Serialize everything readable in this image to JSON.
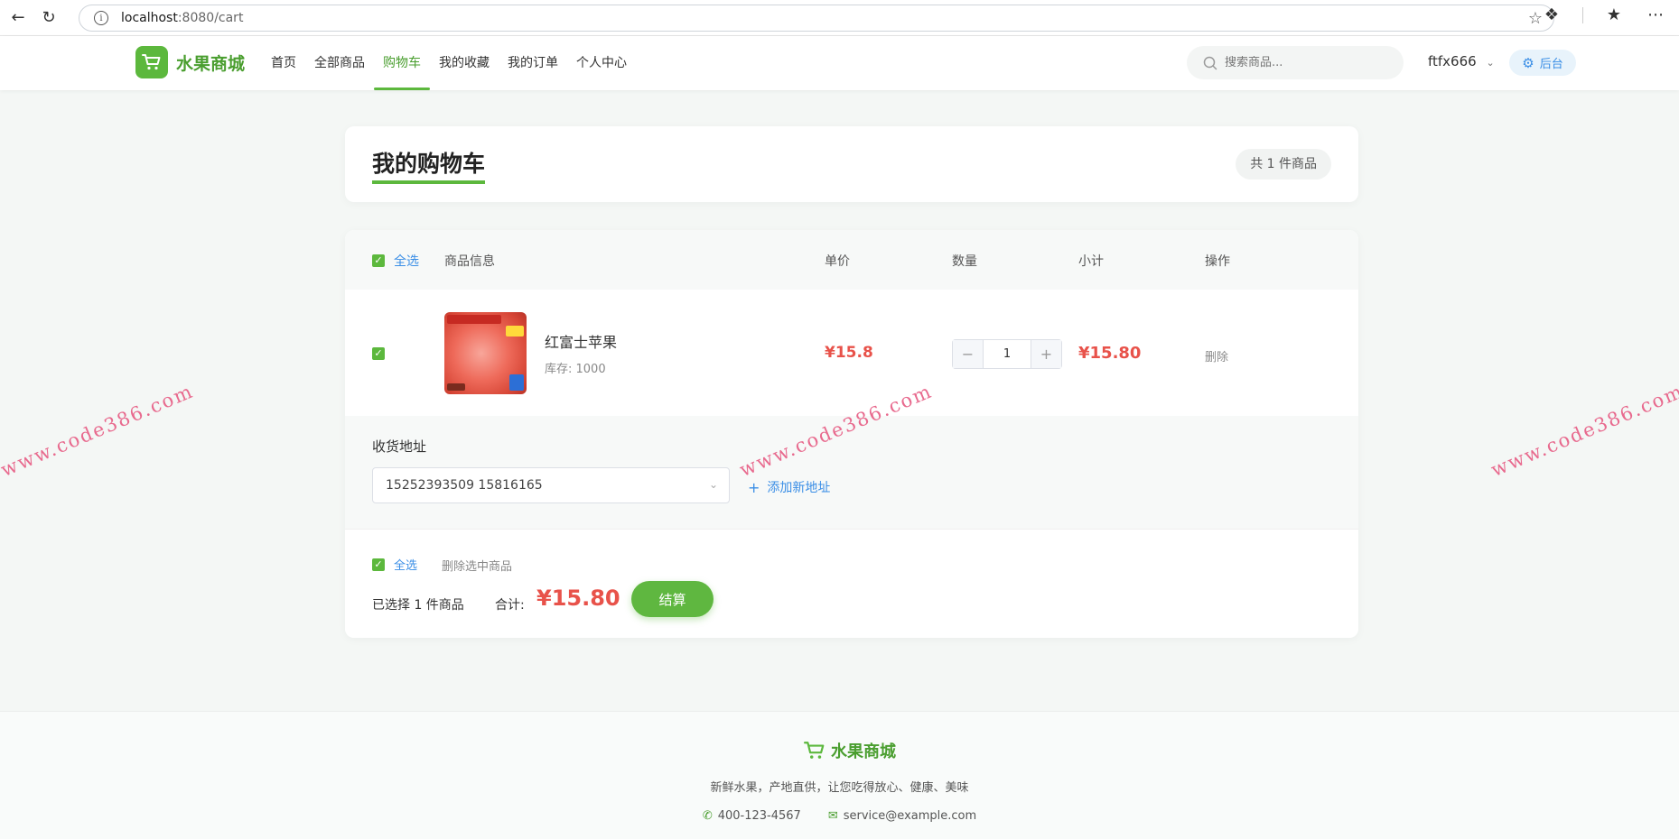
{
  "browser": {
    "back_icon": "arrow-left-icon",
    "reload_icon": "reload-icon",
    "url_host": "localhost",
    "url_path": ":8080/cart"
  },
  "header": {
    "logo_text": "水果商城",
    "nav": [
      {
        "label": "首页"
      },
      {
        "label": "全部商品"
      },
      {
        "label": "购物车",
        "active": true
      },
      {
        "label": "我的收藏"
      },
      {
        "label": "我的订单"
      },
      {
        "label": "个人中心"
      }
    ],
    "search_placeholder": "搜索商品...",
    "username": "ftfx666",
    "admin_label": "后台"
  },
  "title_card": {
    "title": "我的购物车",
    "count_badge": "共 1 件商品"
  },
  "table": {
    "select_all": "全选",
    "columns": [
      "商品信息",
      "单价",
      "数量",
      "小计",
      "操作"
    ]
  },
  "items": [
    {
      "name": "红富士苹果",
      "stock": "库存: 1000",
      "price": "¥15.8",
      "quantity": "1",
      "subtotal": "¥15.80",
      "delete": "删除",
      "checked": true
    }
  ],
  "address": {
    "title": "收货地址",
    "selected": "15252393509 15816165",
    "add_label": "添加新地址"
  },
  "summary": {
    "select_all": "全选",
    "delete_selected": "删除选中商品",
    "selected_count": "已选择 1 件商品",
    "total_label": "合计:",
    "total_value": "¥15.80",
    "checkout": "结算"
  },
  "footer": {
    "logo_text": "水果商城",
    "slogan": "新鲜水果，产地直供，让您吃得放心、健康、美味",
    "phone": "400-123-4567",
    "email": "service@example.com"
  },
  "watermark": "www.code386.com",
  "colors": {
    "brand_green": "#5cb83d",
    "price_red": "#e8524a",
    "link_blue": "#3a8ee6"
  }
}
